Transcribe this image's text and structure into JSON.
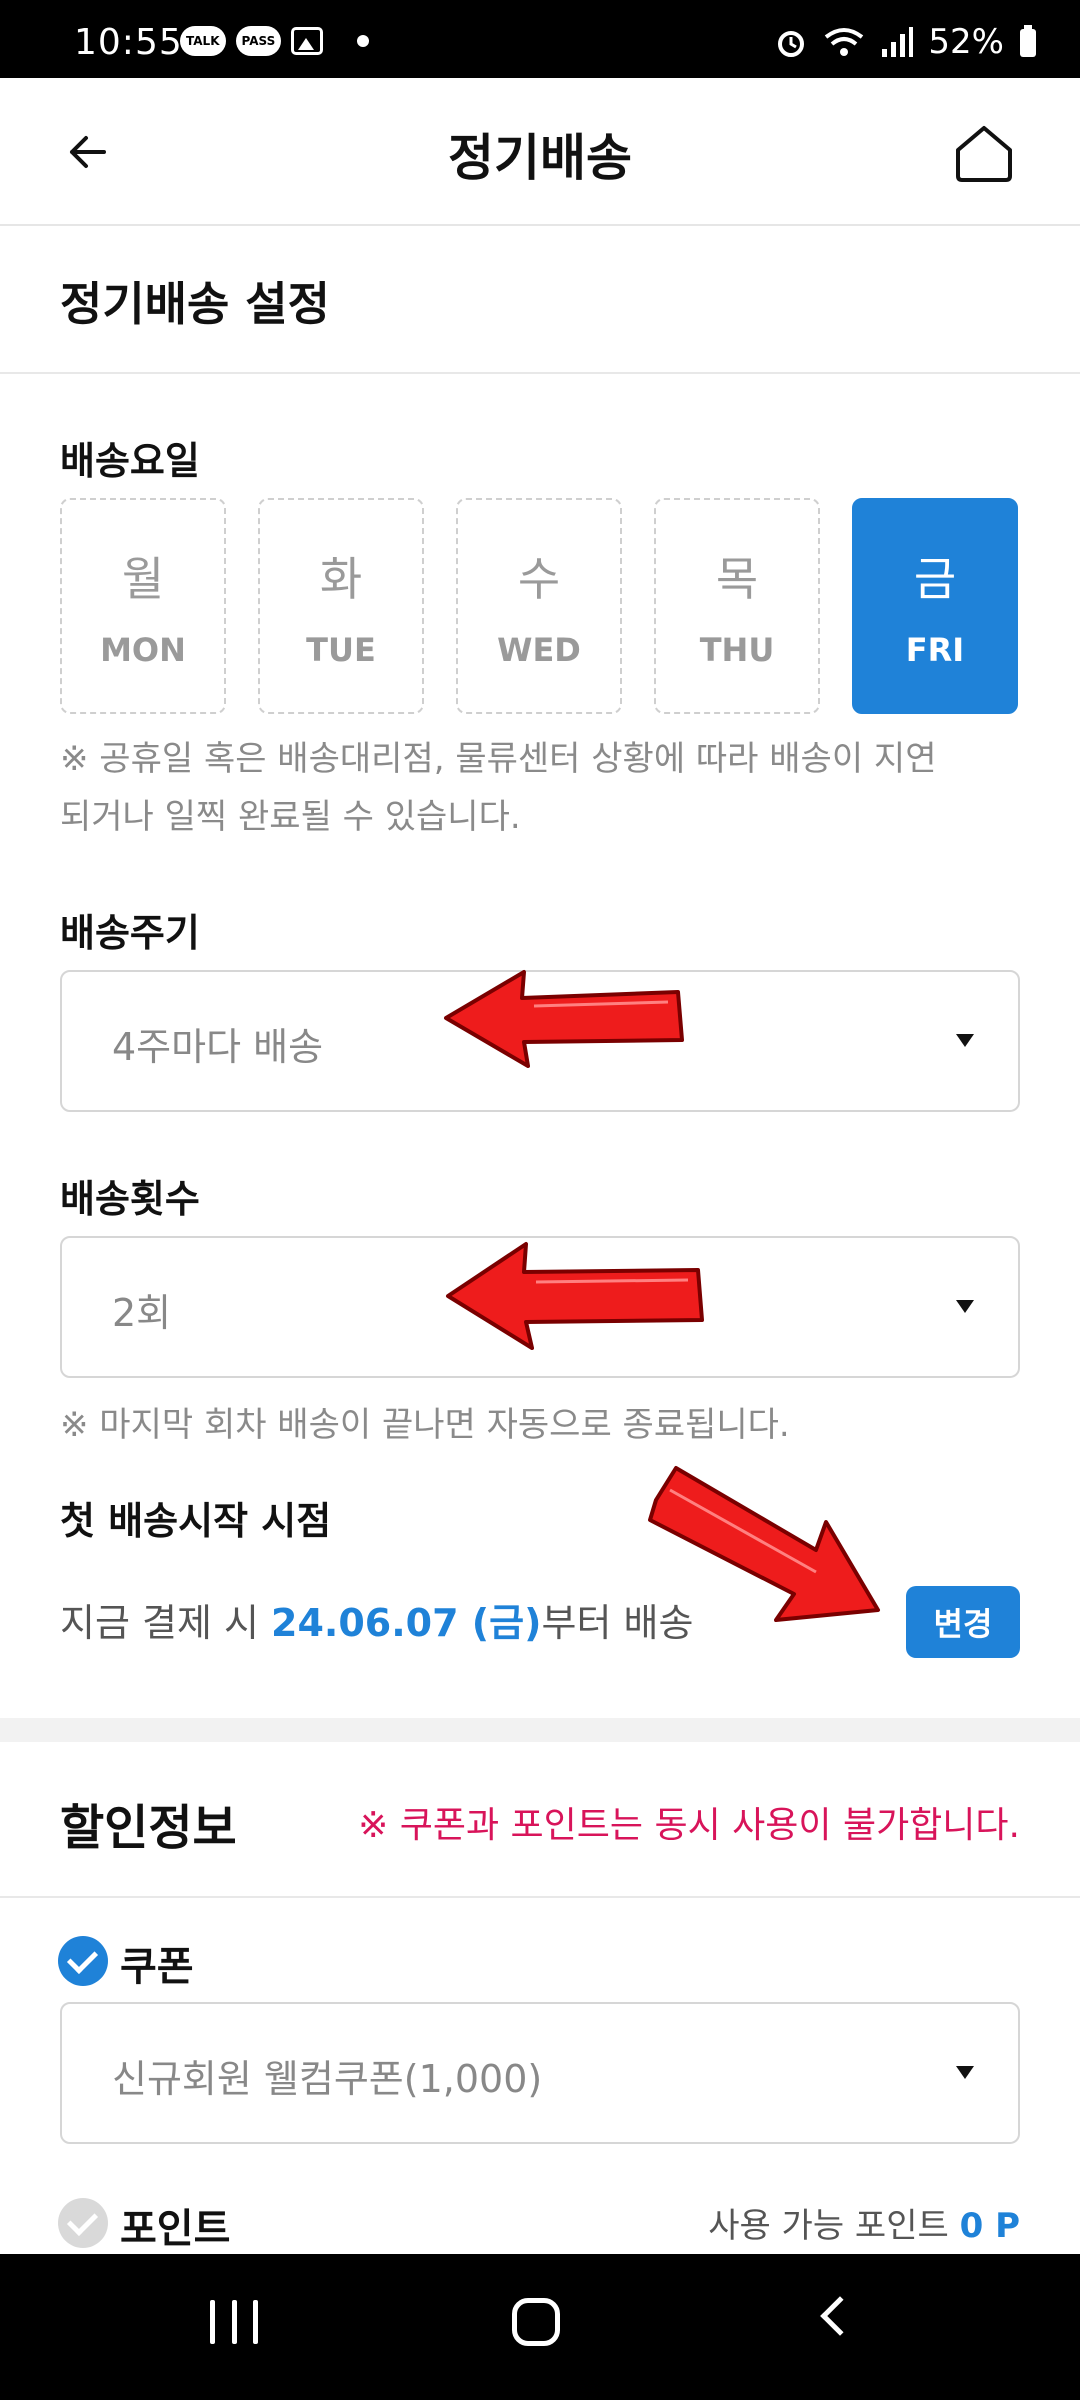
{
  "status_bar": {
    "time": "10:55",
    "talk": "TALK",
    "pass": "PASS",
    "battery": "52%"
  },
  "header": {
    "title": "정기배송"
  },
  "settings": {
    "title": "정기배송 설정",
    "day_label": "배송요일",
    "days": [
      {
        "ko": "월",
        "en": "MON",
        "selected": false
      },
      {
        "ko": "화",
        "en": "TUE",
        "selected": false
      },
      {
        "ko": "수",
        "en": "WED",
        "selected": false
      },
      {
        "ko": "목",
        "en": "THU",
        "selected": false
      },
      {
        "ko": "금",
        "en": "FRI",
        "selected": true
      }
    ],
    "day_note_line1": "※ 공휴일 혹은 배송대리점, 물류센터 상황에 따라 배송이 지연",
    "day_note_line2": "되거나 일찍 완료될 수 있습니다.",
    "cycle_label": "배송주기",
    "cycle_value": "4주마다 배송",
    "count_label": "배송횟수",
    "count_value": "2회",
    "count_note": "※ 마지막 회차 배송이 끝나면 자동으로 종료됩니다.",
    "start_label": "첫 배송시작 시점",
    "start_prefix": "지금 결제 시 ",
    "start_date": "24.06.07 (금)",
    "start_suffix": "부터 배송",
    "change_button": "변경"
  },
  "discount": {
    "title": "할인정보",
    "warning": "※ 쿠폰과 포인트는 동시 사용이 불가합니다.",
    "coupon_label": "쿠폰",
    "coupon_checked": true,
    "coupon_value": "신규회원 웰컴쿠폰(1,000)",
    "point_label": "포인트",
    "point_checked": false,
    "point_available_label": "사용 가능 포인트 ",
    "point_available_value": "0 P"
  },
  "colors": {
    "accent": "#1f82d8",
    "warning": "#d8145a",
    "annotation_arrow": "#ee1c1c"
  }
}
